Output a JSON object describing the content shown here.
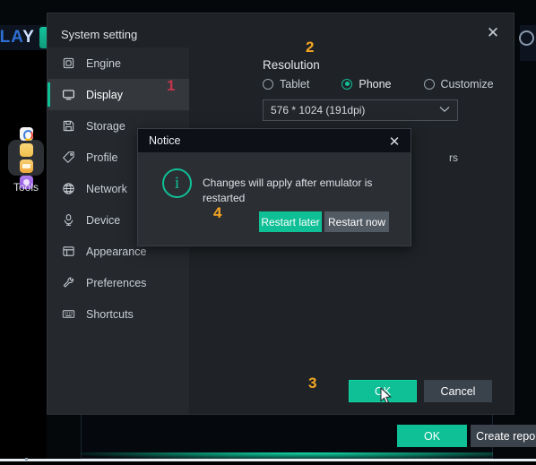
{
  "background": {
    "logo_text": "PLA",
    "logo_text_tail": "Y",
    "tools_label": "Tools",
    "tools_icons": [
      "google-app-icon",
      "yellow-app-icon",
      "notes-app-icon",
      "purple-app-icon"
    ],
    "dialog": {
      "ok_label": "OK",
      "create_report_label": "Create report"
    }
  },
  "window": {
    "title": "System setting",
    "close_icon": "✕",
    "sidebar": {
      "items": [
        {
          "label": "Engine",
          "icon": "engine-icon",
          "active": false
        },
        {
          "label": "Display",
          "icon": "display-icon",
          "active": true
        },
        {
          "label": "Storage",
          "icon": "storage-icon",
          "active": false
        },
        {
          "label": "Profile",
          "icon": "profile-icon",
          "active": false
        },
        {
          "label": "Network",
          "icon": "network-icon",
          "active": false
        },
        {
          "label": "Device",
          "icon": "device-icon",
          "active": false
        },
        {
          "label": "Appearance",
          "icon": "appearance-icon",
          "active": false
        },
        {
          "label": "Preferences",
          "icon": "preferences-icon",
          "active": false
        },
        {
          "label": "Shortcuts",
          "icon": "shortcuts-icon",
          "active": false
        }
      ]
    },
    "content": {
      "section_title": "Resolution",
      "radios": [
        {
          "label": "Tablet",
          "selected": false
        },
        {
          "label": "Phone",
          "selected": true
        },
        {
          "label": "Customize",
          "selected": false
        }
      ],
      "resolution_select": {
        "value": "576 * 1024 (191dpi)",
        "chevron": "⌄"
      },
      "obscured_text": "rs"
    },
    "footer": {
      "ok_label": "OK",
      "cancel_label": "Cancel"
    }
  },
  "notice": {
    "title": "Notice",
    "close_icon": "✕",
    "info_icon": "i",
    "message": "Changes will apply after emulator is restarted",
    "restart_later_label": "Restart later",
    "restart_now_label": "Restart now"
  },
  "annotations": {
    "one": "1",
    "two": "2",
    "three": "3",
    "four": "4"
  },
  "colors": {
    "accent_teal": "#0fbf95",
    "annotation_orange": "#f5a623",
    "annotation_red": "#c4344a",
    "window_bg": "#1f2327",
    "sidebar_bg": "#25292e"
  }
}
